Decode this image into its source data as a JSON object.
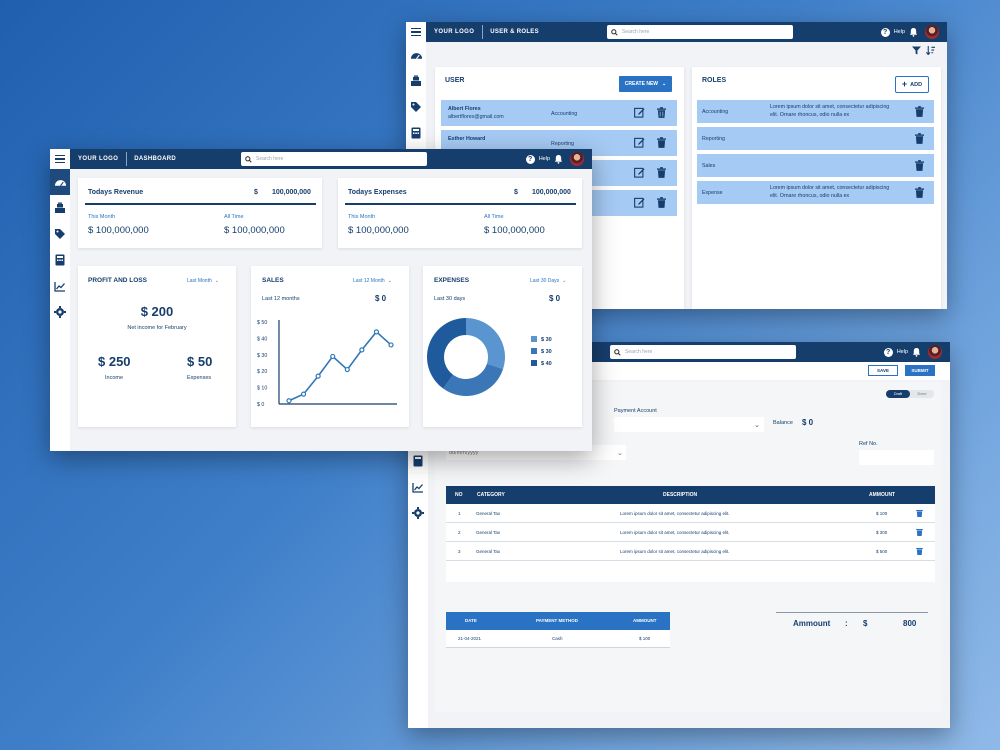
{
  "users_roles": {
    "logo": "YOUR LOGO",
    "breadcrumb": "USER & ROLES",
    "search_placeholder": "Search here",
    "help": "Help",
    "user_title": "USER",
    "create_new": "CREATE NEW",
    "roles_title": "ROLES",
    "add_label": "ADD",
    "users": [
      {
        "name": "Albert Flores",
        "email": "albertflores@gmail.com",
        "dept": "Accounting"
      },
      {
        "name": "Esther Howard",
        "email": "",
        "dept": "Reporting"
      }
    ],
    "roles": [
      {
        "name": "Accounting",
        "desc": "Lorem ipsum dolor sit amet, consectetur adipiscing elit. Ornare rhoncus, odio nulla ex"
      },
      {
        "name": "Reporting",
        "desc": ""
      },
      {
        "name": "Sales",
        "desc": ""
      },
      {
        "name": "Expense",
        "desc": "Lorem ipsum dolor sit amet, consectetur adipiscing elit. Ornare rhoncus, odio nulla ex"
      }
    ]
  },
  "payment": {
    "search_placeholder": "Search here",
    "help": "Help",
    "save": "SAVE",
    "submit": "SUBMIT",
    "status_active": "Draft",
    "status_other": "Done",
    "payment_account_label": "Payment Account",
    "balance_label": "Balance",
    "balance_value": "$ 0",
    "date_placeholder": "dd/mm/yyyy",
    "ref_label": "Ref No.",
    "table_headers": {
      "no": "NO",
      "category": "CATEGORY",
      "description": "DESCRIPTION",
      "amount": "AMMOUNT"
    },
    "rows": [
      {
        "no": "1",
        "category": "General Tax",
        "description": "Lorem ipsum dolor sit amet, consectetur adipiscing elit.",
        "amount": "$ 100"
      },
      {
        "no": "2",
        "category": "General Tax",
        "description": "Lorem ipsum dolor sit amet, consectetur adipiscing elit.",
        "amount": "$ 300"
      },
      {
        "no": "3",
        "category": "General Tax",
        "description": "Lorem ipsum dolor sit amet, consectetur adipiscing elit.",
        "amount": "$ 500"
      }
    ],
    "pay_headers": {
      "date": "DATE",
      "method": "PAYMENT METHOD",
      "amount": "AMMOUNT"
    },
    "pay_rows": [
      {
        "date": "21-04-2021",
        "method": "Cash",
        "amount": "$ 100"
      }
    ],
    "total_label": "Ammount",
    "total_colon": ":",
    "total_currency": "$",
    "total_value": "800"
  },
  "dashboard": {
    "logo": "YOUR LOGO",
    "breadcrumb": "DASHBOARD",
    "search_placeholder": "Search here",
    "help": "Help",
    "revenue": {
      "title": "Todays Revenue",
      "currency": "$",
      "value": "100,000,000",
      "this_month_label": "This Month",
      "this_month_value": "$ 100,000,000",
      "all_time_label": "All Time",
      "all_time_value": "$ 100,000,000"
    },
    "expenses": {
      "title": "Todays Expenses",
      "currency": "$",
      "value": "100,000,000",
      "this_month_label": "This Month",
      "this_month_value": "$ 100,000,000",
      "all_time_label": "All Time",
      "all_time_value": "$ 100,000,000"
    },
    "pnl": {
      "title": "PROFIT AND LOSS",
      "filter": "Last Month",
      "net_value": "$ 200",
      "net_label": "Net income for February",
      "income_value": "$ 250",
      "income_label": "Income",
      "expenses_value": "$ 50",
      "expenses_label": "Expenses"
    },
    "sales": {
      "title": "SALES",
      "filter": "Last 12 Month",
      "period": "Last 12 months",
      "value": "$ 0"
    },
    "expense_card": {
      "title": "EXPENSES",
      "filter": "Last 30 Days",
      "period": "Last 30 days",
      "value": "$ 0"
    }
  },
  "chart_data": [
    {
      "type": "line",
      "title": "SALES",
      "yticks": [
        "$ 50",
        "$ 40",
        "$ 30",
        "$ 20",
        "$ 10",
        "$ 0"
      ],
      "ylim": [
        0,
        50
      ],
      "values": [
        2,
        6,
        17,
        29,
        21,
        33,
        44,
        36
      ],
      "color": "#2f77b7"
    },
    {
      "type": "pie",
      "title": "EXPENSES",
      "legend": [
        "$ 30",
        "$ 30",
        "$ 40"
      ],
      "values": [
        30,
        30,
        40
      ],
      "colors": [
        "#5b95cf",
        "#3b77b7",
        "#1f5b9c"
      ]
    }
  ]
}
